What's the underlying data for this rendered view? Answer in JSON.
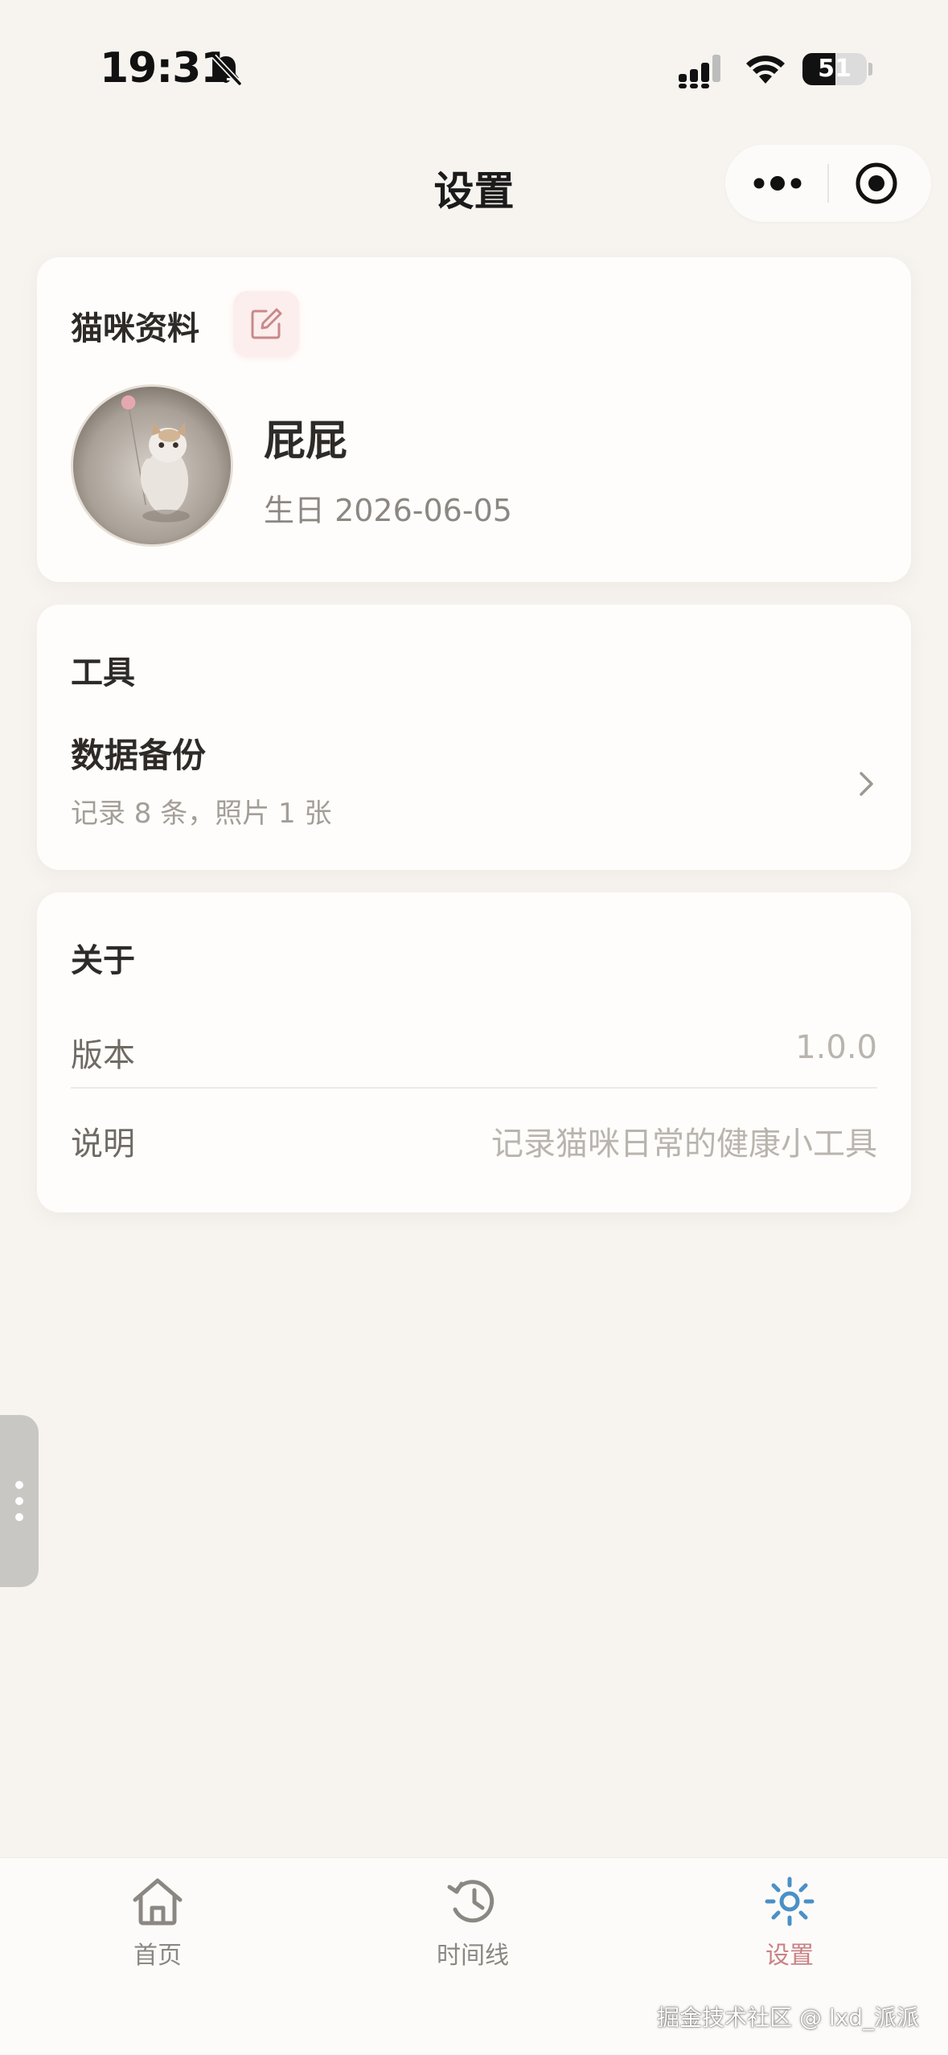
{
  "status_bar": {
    "time": "19:31",
    "battery_level": "51",
    "battery_fraction": 0.51,
    "icons": [
      "bell-muted-icon",
      "cell-signal-icon",
      "wifi-icon",
      "battery-icon"
    ]
  },
  "nav": {
    "title": "设置",
    "capsule_icons": [
      "more-dots-icon",
      "target-close-icon"
    ]
  },
  "profile": {
    "section_title": "猫咪资料",
    "edit_icon": "edit-icon",
    "cat_name": "屁屁",
    "birthday": "生日 2026-06-05"
  },
  "tools": {
    "section_title": "工具",
    "backup_title": "数据备份",
    "backup_summary": "记录 8 条，照片 1 张"
  },
  "about": {
    "section_title": "关于",
    "rows": [
      {
        "label": "版本",
        "value": "1.0.0"
      },
      {
        "label": "说明",
        "value": "记录猫咪日常的健康小工具"
      }
    ]
  },
  "tab_bar": {
    "active_index": 2,
    "accent_color": "#c98286",
    "active_icon_color": "#4a90c8",
    "tabs": [
      {
        "label": "首页",
        "icon": "home-icon"
      },
      {
        "label": "时间线",
        "icon": "history-icon"
      },
      {
        "label": "设置",
        "icon": "settings-sun-icon"
      }
    ]
  },
  "watermark": "掘金技术社区 @ lxd_派派"
}
